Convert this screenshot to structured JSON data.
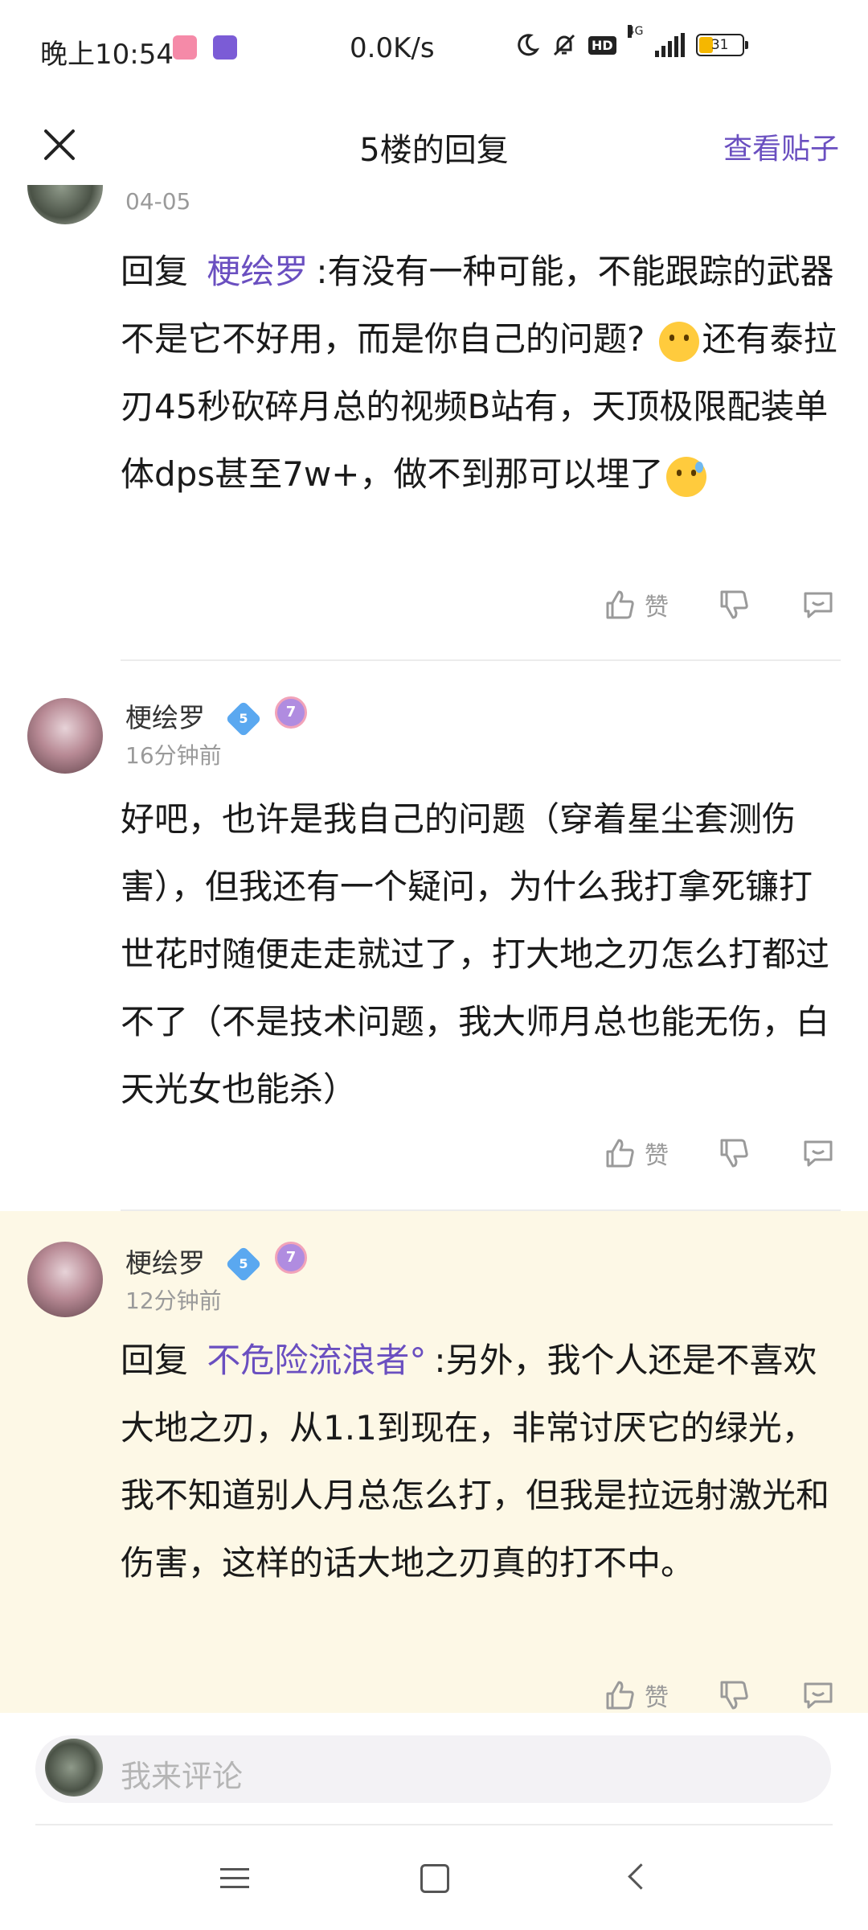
{
  "status_bar": {
    "time": "晚上10:54",
    "speed": "0.0K/s",
    "network": "4G",
    "hd": "HD",
    "battery": "31"
  },
  "header": {
    "title": "5楼的回复",
    "view_post": "查看贴子"
  },
  "posts": [
    {
      "time": "04-05",
      "reply_prefix": "回复",
      "mention": "梗绘罗",
      "text1": ":有没有一种可能，不能跟踪的武器不是它不好用，而是你自己的问题?",
      "text2": "还有泰拉刃45秒砍碎月总的视频B站有，天顶极限配装单体dps甚至7w+，做不到那可以埋了",
      "like_label": "赞"
    },
    {
      "username": "梗绘罗",
      "level": "5",
      "medal": "7",
      "time": "16分钟前",
      "text": "好吧，也许是我自己的问题（穿着星尘套测伤害），但我还有一个疑问，为什么我打拿死镰打世花时随便走走就过了，打大地之刃怎么打都过不了（不是技术问题，我大师月总也能无伤，白天光女也能杀）",
      "like_label": "赞"
    },
    {
      "username": "梗绘罗",
      "level": "5",
      "medal": "7",
      "time": "12分钟前",
      "reply_prefix": "回复",
      "mention": "不危险流浪者°",
      "text": ":另外，我个人还是不喜欢大地之刃，从1.1到现在，非常讨厌它的绿光，我不知道别人月总怎么打，但我是拉远射激光和伤害，这样的话大地之刃真的打不中。",
      "like_label": "赞"
    }
  ],
  "comment_bar": {
    "placeholder": "我来评论"
  },
  "colors": {
    "accent": "#6a4fc0",
    "highlight_bg": "#fdf8e6"
  }
}
